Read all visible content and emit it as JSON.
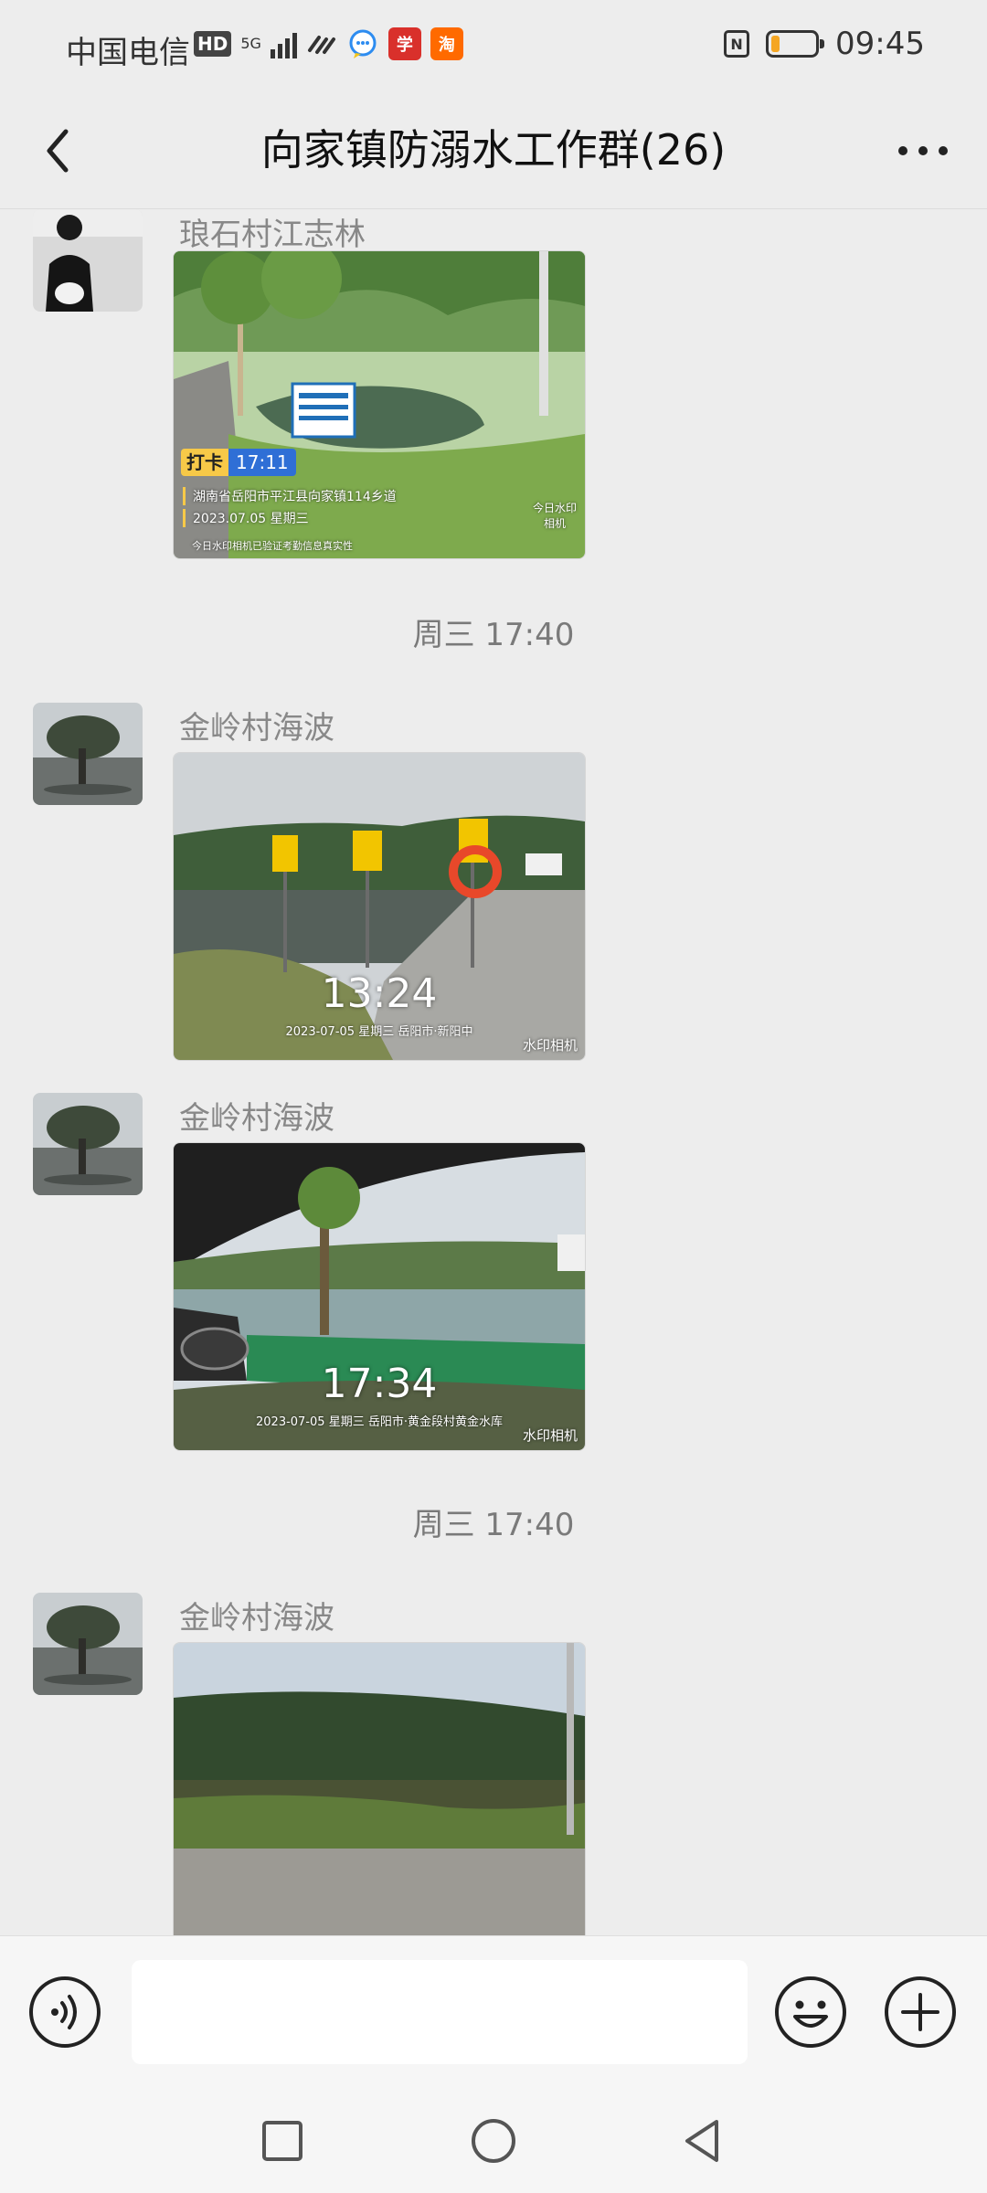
{
  "status_bar": {
    "carrier": "中国电信",
    "hd": "HD",
    "network": "5G",
    "app_badge_1": "学",
    "app_badge_2": "淘",
    "time": "09:45",
    "nfc": "N",
    "battery_level": 0.2
  },
  "header": {
    "title": "向家镇防溺水工作群(26)"
  },
  "messages": [
    {
      "sender": "琅石村江志林",
      "photo": {
        "daka_tag": "打卡",
        "daka_time": "17:11",
        "address": "湖南省岳阳市平江县向家镇114乡道",
        "date": "2023.07.05 星期三",
        "footer": "今日水印相机已验证考勤信息真实性",
        "brand": "今日水印相机"
      }
    },
    {
      "type": "time",
      "text": "周三 17:40"
    },
    {
      "sender": "金岭村海波",
      "photo": {
        "time": "13:24",
        "caption": "2023-07-05 星期三 岳阳市·新阳中",
        "brand": "水印相机"
      }
    },
    {
      "sender": "金岭村海波",
      "photo": {
        "time": "17:34",
        "caption": "2023-07-05 星期三 岳阳市·黄金段村黄金水库",
        "brand": "水印相机"
      }
    },
    {
      "type": "time",
      "text": "周三 17:40"
    },
    {
      "sender": "金岭村海波"
    }
  ],
  "icons": {
    "back": "chevron-left-icon",
    "more": "more-dots-icon",
    "voice": "voice-icon",
    "emoji": "emoji-icon",
    "plus": "plus-icon"
  }
}
